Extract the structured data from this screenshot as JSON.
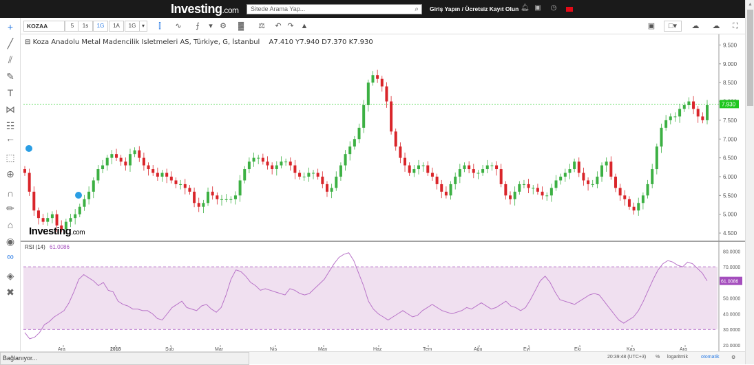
{
  "header": {
    "logo_text": "Investing",
    "logo_suffix": ".com",
    "search_placeholder": "Sitede Arama Yap...",
    "login_text": "Giriş Yapın / Ücretsiz Kayıt Olun"
  },
  "toolbar": {
    "symbol": "KOZAA",
    "timeframes": [
      "5",
      "1s",
      "1G",
      "1A",
      "1G"
    ],
    "active_timeframe_index": 2
  },
  "chart": {
    "title": "Koza Anadolu Metal Madencilik Isletmeleri AS, Türkiye, G, İstanbul",
    "ohlc": "A7.410  Y7.940  D7.370  K7.930",
    "current_price_label": "7.930",
    "rsi_title": "RSI (14)",
    "rsi_value": "61.0086",
    "watermark": "Investing",
    "watermark_suffix": ".com",
    "price_axis": [
      "9.500",
      "9.000",
      "8.500",
      "8.000",
      "7.500",
      "7.000",
      "6.500",
      "6.000",
      "5.500",
      "5.000",
      "4.500"
    ],
    "rsi_axis": [
      "80.0000",
      "70.0000",
      "50.0000",
      "40.0000",
      "30.0000",
      "20.0000"
    ],
    "time_axis": [
      "Ara",
      "2018",
      "Şub",
      "Mar",
      "Nis",
      "May",
      "Haz",
      "Tem",
      "Ağu",
      "Eyl",
      "Eki",
      "Kas",
      "Ara"
    ],
    "colors": {
      "up": "#3cb043",
      "down": "#d9252a",
      "rsi": "#b873c8",
      "rsi_band": "#f0e0f0",
      "price_line": "#2fd02f"
    }
  },
  "chart_data": {
    "type": "candlestick",
    "series": [
      {
        "name": "Koza Anadolu Metal Madencilik Isletmeleri AS",
        "values": [
          6.1,
          5.6,
          5.1,
          4.9,
          4.8,
          4.9,
          5.0,
          4.7,
          4.6,
          4.8,
          4.9,
          5.0,
          5.2,
          5.4,
          5.6,
          5.9,
          6.2,
          6.3,
          6.5,
          6.6,
          6.5,
          6.4,
          6.3,
          6.6,
          6.7,
          6.5,
          6.3,
          6.2,
          6.1,
          6.0,
          6.1,
          6.0,
          5.9,
          5.8,
          5.8,
          5.7,
          5.6,
          5.3,
          5.2,
          5.3,
          5.6,
          5.5,
          5.4,
          5.4,
          5.4,
          5.4,
          5.5,
          5.9,
          6.2,
          6.4,
          6.5,
          6.5,
          6.4,
          6.3,
          6.2,
          6.3,
          6.4,
          6.4,
          6.3,
          6.1,
          6.0,
          6.0,
          6.1,
          6.1,
          6.0,
          5.8,
          5.6,
          5.7,
          6.0,
          6.3,
          6.6,
          6.8,
          7.0,
          7.3,
          7.9,
          8.5,
          8.7,
          8.6,
          8.4,
          8.0,
          7.2,
          6.8,
          6.5,
          6.3,
          6.1,
          6.2,
          6.3,
          6.3,
          6.1,
          6.0,
          5.8,
          5.6,
          5.5,
          5.8,
          6.0,
          6.2,
          6.3,
          6.2,
          6.1,
          6.1,
          6.2,
          6.3,
          6.3,
          6.2,
          5.8,
          5.5,
          5.4,
          5.6,
          5.8,
          5.8,
          5.7,
          5.7,
          5.6,
          5.5,
          5.5,
          5.7,
          5.9,
          6.0,
          6.1,
          6.2,
          6.4,
          6.1,
          5.9,
          5.8,
          5.8,
          6.0,
          6.3,
          6.4,
          6.0,
          5.7,
          5.5,
          5.4,
          5.2,
          5.1,
          5.3,
          5.5,
          5.8,
          6.2,
          6.8,
          7.3,
          7.5,
          7.6,
          7.6,
          7.8,
          7.9,
          8.0,
          7.8,
          7.6,
          7.5,
          7.9
        ]
      },
      {
        "name": "RSI (14)",
        "values": [
          28,
          24,
          25,
          28,
          33,
          35,
          38,
          40,
          42,
          47,
          54,
          62,
          65,
          63,
          61,
          58,
          60,
          55,
          54,
          48,
          46,
          45,
          43,
          43,
          42,
          42,
          40,
          37,
          36,
          40,
          44,
          46,
          48,
          44,
          43,
          42,
          45,
          46,
          43,
          41,
          44,
          52,
          62,
          68,
          67,
          64,
          60,
          58,
          55,
          56,
          55,
          54,
          53,
          52,
          56,
          55,
          53,
          52,
          53,
          56,
          59,
          62,
          67,
          72,
          76,
          78,
          79,
          74,
          66,
          58,
          48,
          43,
          40,
          38,
          36,
          38,
          40,
          42,
          40,
          38,
          39,
          42,
          44,
          46,
          44,
          42,
          41,
          40,
          41,
          42,
          44,
          43,
          45,
          47,
          45,
          43,
          44,
          46,
          48,
          45,
          44,
          42,
          44,
          49,
          55,
          61,
          64,
          60,
          54,
          49,
          48,
          47,
          46,
          48,
          50,
          52,
          53,
          52,
          48,
          44,
          40,
          36,
          34,
          36,
          38,
          42,
          48,
          55,
          62,
          68,
          72,
          74,
          73,
          71,
          70,
          73,
          72,
          69,
          66,
          61
        ]
      }
    ],
    "xlabel": "",
    "ylabel": "",
    "ylim": [
      4.3,
      9.6
    ],
    "rsi_ylim": [
      20,
      85
    ],
    "rsi_bands": [
      30,
      70
    ],
    "last_close": 7.93
  }
}
